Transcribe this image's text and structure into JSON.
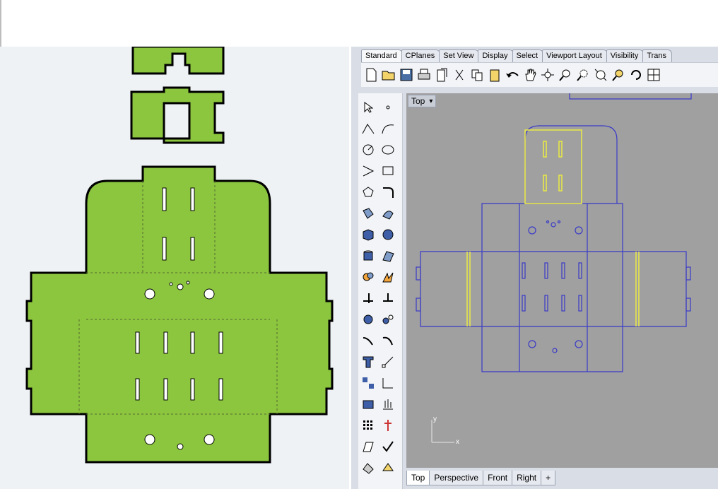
{
  "toolbar_tabs": [
    "Standard",
    "CPlanes",
    "Set View",
    "Display",
    "Select",
    "Viewport Layout",
    "Visibility",
    "Trans"
  ],
  "viewport": {
    "label": "Top",
    "menu_arrow": "▾"
  },
  "axes": {
    "x": "x",
    "y": "y"
  },
  "bottom_tabs": [
    "Top",
    "Perspective",
    "Front",
    "Right"
  ],
  "add_tab_icon": "+",
  "toolbar_icons": [
    "new-icon",
    "open-icon",
    "save-icon",
    "print-icon",
    "import-icon",
    "cut-icon",
    "copy-icon",
    "paste-icon",
    "undo-icon",
    "pan-icon",
    "move-view-icon",
    "zoom-icon",
    "zoom-window-icon",
    "zoom-extents-icon",
    "zoom-selected-icon",
    "rotate-view-icon",
    "viewport-layout-icon"
  ],
  "colors": {
    "shape_green": "#8cc63f",
    "curve_blue": "#3a3ac8",
    "selected_yellow": "#e6e64a",
    "viewport_gray": "#a0a0a0"
  }
}
